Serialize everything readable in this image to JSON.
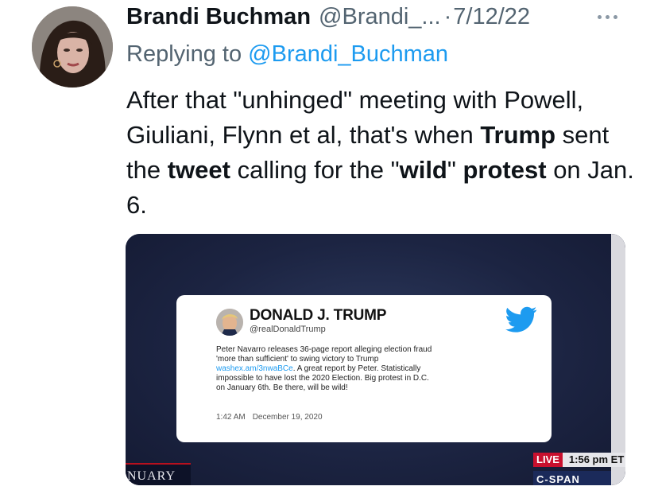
{
  "tweet": {
    "author_name": "Brandi Buchman",
    "author_handle": "@Brandi_...",
    "separator": "·",
    "date": "7/12/22",
    "more_icon": "more-icon",
    "reply_prefix": "Replying to",
    "reply_mention": "@Brandi_Buchman",
    "text_segments": [
      {
        "text": "After that \"unhinged\" meeting with Powell, Giuliani, Flynn et al, that's when ",
        "bold": false
      },
      {
        "text": "Trump",
        "bold": true
      },
      {
        "text": " sent the ",
        "bold": false
      },
      {
        "text": "tweet",
        "bold": true
      },
      {
        "text": " calling for the \"",
        "bold": false
      },
      {
        "text": "wild",
        "bold": true
      },
      {
        "text": "\" ",
        "bold": false
      },
      {
        "text": "protest",
        "bold": true
      },
      {
        "text": " on Jan. 6.",
        "bold": false
      }
    ]
  },
  "media": {
    "lower_third": "NUARY",
    "live_label": "LIVE",
    "live_time": "1:56 pm ET",
    "network_partial": "C-SPAN",
    "embedded_tweet": {
      "name": "DONALD J. TRUMP",
      "handle": "@realDonaldTrump",
      "body_before_link": "Peter Navarro releases 36-page report alleging election fraud\n'more than sufficient' to swing victory to Trump",
      "link": "washex.am/3nwaBCe",
      "body_after_link": ". A great report by Peter. Statistically\nimpossible to have lost the 2020 Election. Big protest in D.C.\non January 6th. Be there, will be wild!",
      "time": "1:42 AM",
      "date": "December 19, 2020",
      "bird_icon": "twitter-bird-icon",
      "brand_color": "#1d9bf0"
    }
  }
}
